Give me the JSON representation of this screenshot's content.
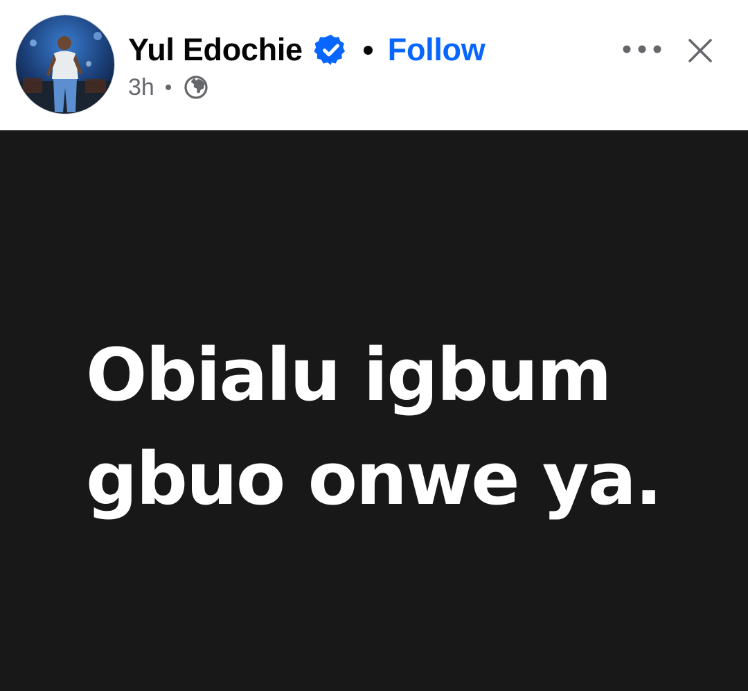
{
  "post": {
    "author": {
      "name": "Yul Edochie",
      "avatar_icon": "profile-photo",
      "verified_icon": "verified-badge-icon"
    },
    "follow_label": "Follow",
    "separator": "•",
    "timestamp": "3h",
    "audience_icon": "globe-icon",
    "more_icon": "more-options-icon",
    "close_icon": "close-icon",
    "content": {
      "line1": "Obialu igbum",
      "line2": "gbuo onwe ya."
    }
  },
  "colors": {
    "follow": "#0866ff",
    "verified": "#0866ff",
    "name": "#050505",
    "meta": "#65676b",
    "post_background": "#181818",
    "post_text": "#ffffff"
  }
}
